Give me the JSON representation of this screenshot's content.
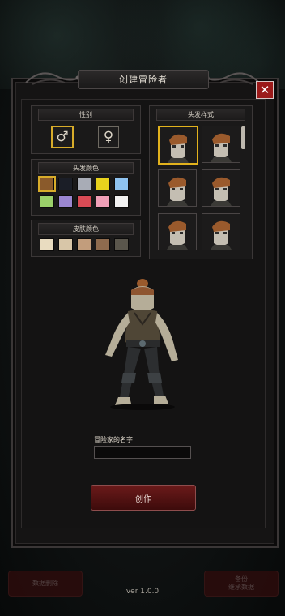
{
  "dialog": {
    "title": "创建冒险者",
    "close_symbol": "✕"
  },
  "gender": {
    "label": "性别",
    "male_symbol": "♂",
    "female_symbol": "♀",
    "selected": "male"
  },
  "hair_color": {
    "label": "头发颜色",
    "swatches": [
      "#8a5a2b",
      "#1b1e27",
      "#a8acb6",
      "#e8d21d",
      "#8fc3f0",
      "#9bd06a",
      "#9b86d0",
      "#d94b55",
      "#f0a0b8",
      "#f2f2f2"
    ],
    "selected_index": 0
  },
  "skin_color": {
    "label": "皮肤颜色",
    "swatches": [
      "#e9dcc0",
      "#d8c6a8",
      "#c29d7c",
      "#8e6b4e",
      "#5a564c"
    ]
  },
  "hair_style": {
    "label": "头发样式",
    "selected_index": 0,
    "count": 6
  },
  "name": {
    "label": "冒险家的名字",
    "value": "",
    "placeholder": ""
  },
  "create_button": "创作",
  "bottom_left_button": "数据删除",
  "bottom_right_button_line1": "备份",
  "bottom_right_button_line2": "继承数据",
  "version": "ver 1.0.0"
}
